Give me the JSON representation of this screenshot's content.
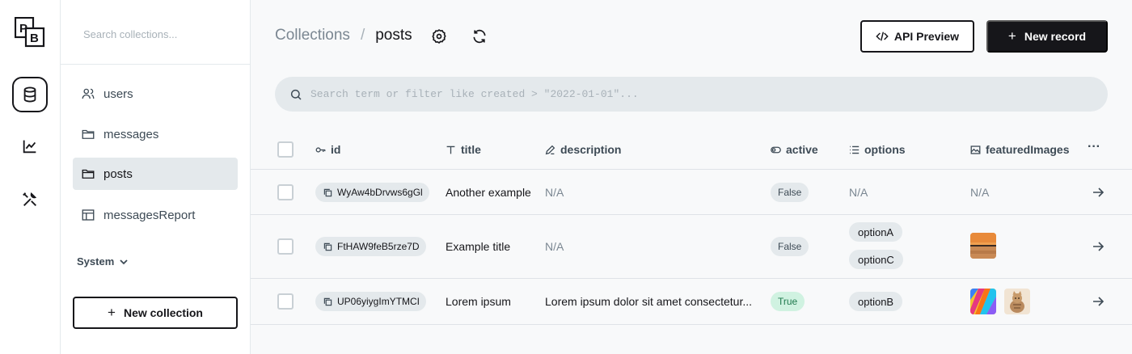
{
  "rail": {
    "logo_text": "PB",
    "items": [
      {
        "name": "collections",
        "icon": "database-icon",
        "active": true
      },
      {
        "name": "logs",
        "icon": "chart-line-icon",
        "active": false
      },
      {
        "name": "settings",
        "icon": "tools-icon",
        "active": false
      }
    ]
  },
  "sidebar": {
    "search_placeholder": "Search collections...",
    "items": [
      {
        "label": "users",
        "icon": "users-icon"
      },
      {
        "label": "messages",
        "icon": "folder-icon"
      },
      {
        "label": "posts",
        "icon": "folder-icon",
        "active": true
      },
      {
        "label": "messagesReport",
        "icon": "table-icon"
      }
    ],
    "system_label": "System",
    "new_collection_label": "New collection"
  },
  "header": {
    "breadcrumb_root": "Collections",
    "breadcrumb_sep": "/",
    "breadcrumb_current": "posts",
    "api_preview_label": "API Preview",
    "new_record_label": "New record"
  },
  "search": {
    "placeholder": "Search term or filter like created > \"2022-01-01\"..."
  },
  "table": {
    "columns": [
      {
        "label": "id",
        "icon": "key-icon"
      },
      {
        "label": "title",
        "icon": "text-icon"
      },
      {
        "label": "description",
        "icon": "pencil-icon"
      },
      {
        "label": "active",
        "icon": "toggle-icon"
      },
      {
        "label": "options",
        "icon": "list-icon"
      },
      {
        "label": "featuredImages",
        "icon": "image-icon"
      }
    ],
    "more_label": "···",
    "rows": [
      {
        "id": "WyAw4bDrvws6gGl",
        "title": "Another example",
        "description": "N/A",
        "active": "False",
        "options": [],
        "images_text": "N/A",
        "images": []
      },
      {
        "id": "FtHAW9feB5rze7D",
        "title": "Example title",
        "description": "N/A",
        "active": "False",
        "options": [
          "optionA",
          "optionC"
        ],
        "images_text": "",
        "images": [
          "beach-sunset-image"
        ]
      },
      {
        "id": "UP06yiygImYTMCI",
        "title": "Lorem ipsum",
        "description": "Lorem ipsum dolor sit amet consectetur...",
        "active": "True",
        "options": [
          "optionB"
        ],
        "images_text": "",
        "images": [
          "colorful-abstract-image",
          "cat-image"
        ]
      }
    ]
  },
  "colors": {
    "primary": "#16161a",
    "muted": "#7b8792",
    "chip_bg": "#e4e9ec",
    "true_badge_bg": "#d0f2e1",
    "true_badge_text": "#1f7a4e"
  }
}
